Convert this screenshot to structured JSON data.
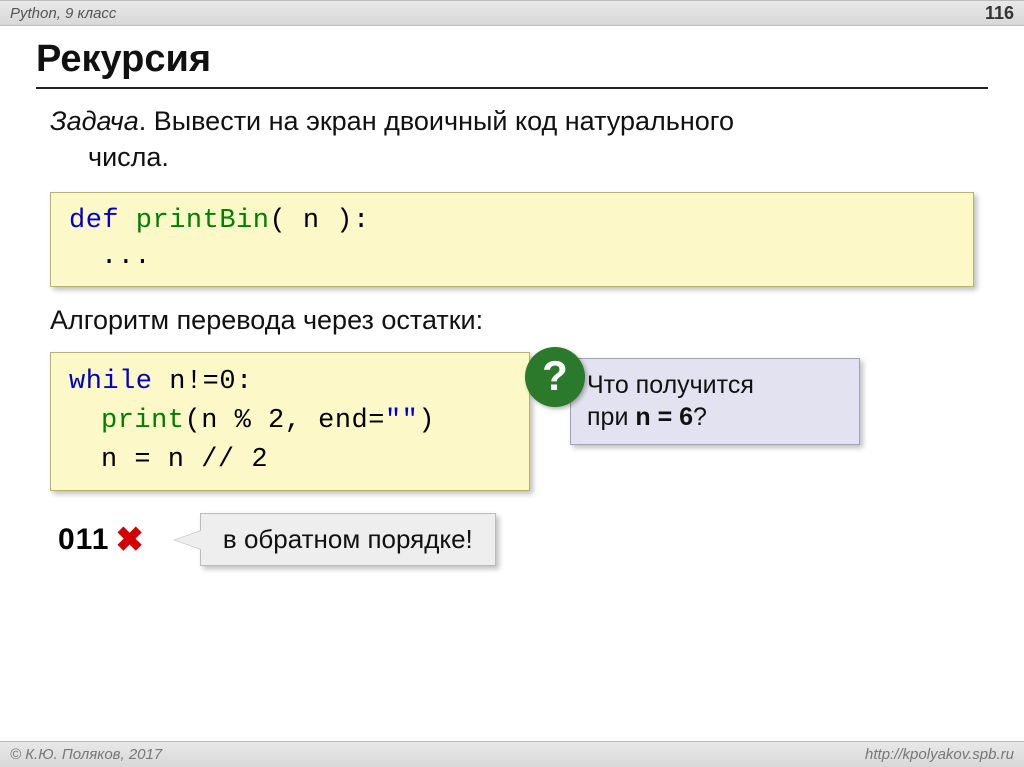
{
  "header": {
    "left": "Python, 9 класс",
    "page": "116"
  },
  "title": "Рекурсия",
  "task": {
    "label": "Задача",
    "text1": ". Вывести на экран двоичный код натурального",
    "text2": "числа."
  },
  "code1": {
    "def": "def",
    "fn": " printBin",
    "params": "( n ):",
    "body": "..."
  },
  "algorithm_label": "Алгоритм перевода через остатки:",
  "code2": {
    "l1_kw": "while",
    "l1_rest": " n!=0:",
    "l2_fn": "print",
    "l2_args_a": "(n % 2, end=",
    "l2_str": "\"\"",
    "l2_args_b": ")",
    "l3": "n = n // 2"
  },
  "callout": {
    "qmark": "?",
    "line1": "Что получится",
    "line2_a": "при ",
    "line2_b": "n = 6",
    "line2_c": "?"
  },
  "result": {
    "value": "011",
    "cross": "✖",
    "note": "в обратном порядке!"
  },
  "footer": {
    "left": "© К.Ю. Поляков, 2017",
    "right": "http://kpolyakov.spb.ru"
  }
}
